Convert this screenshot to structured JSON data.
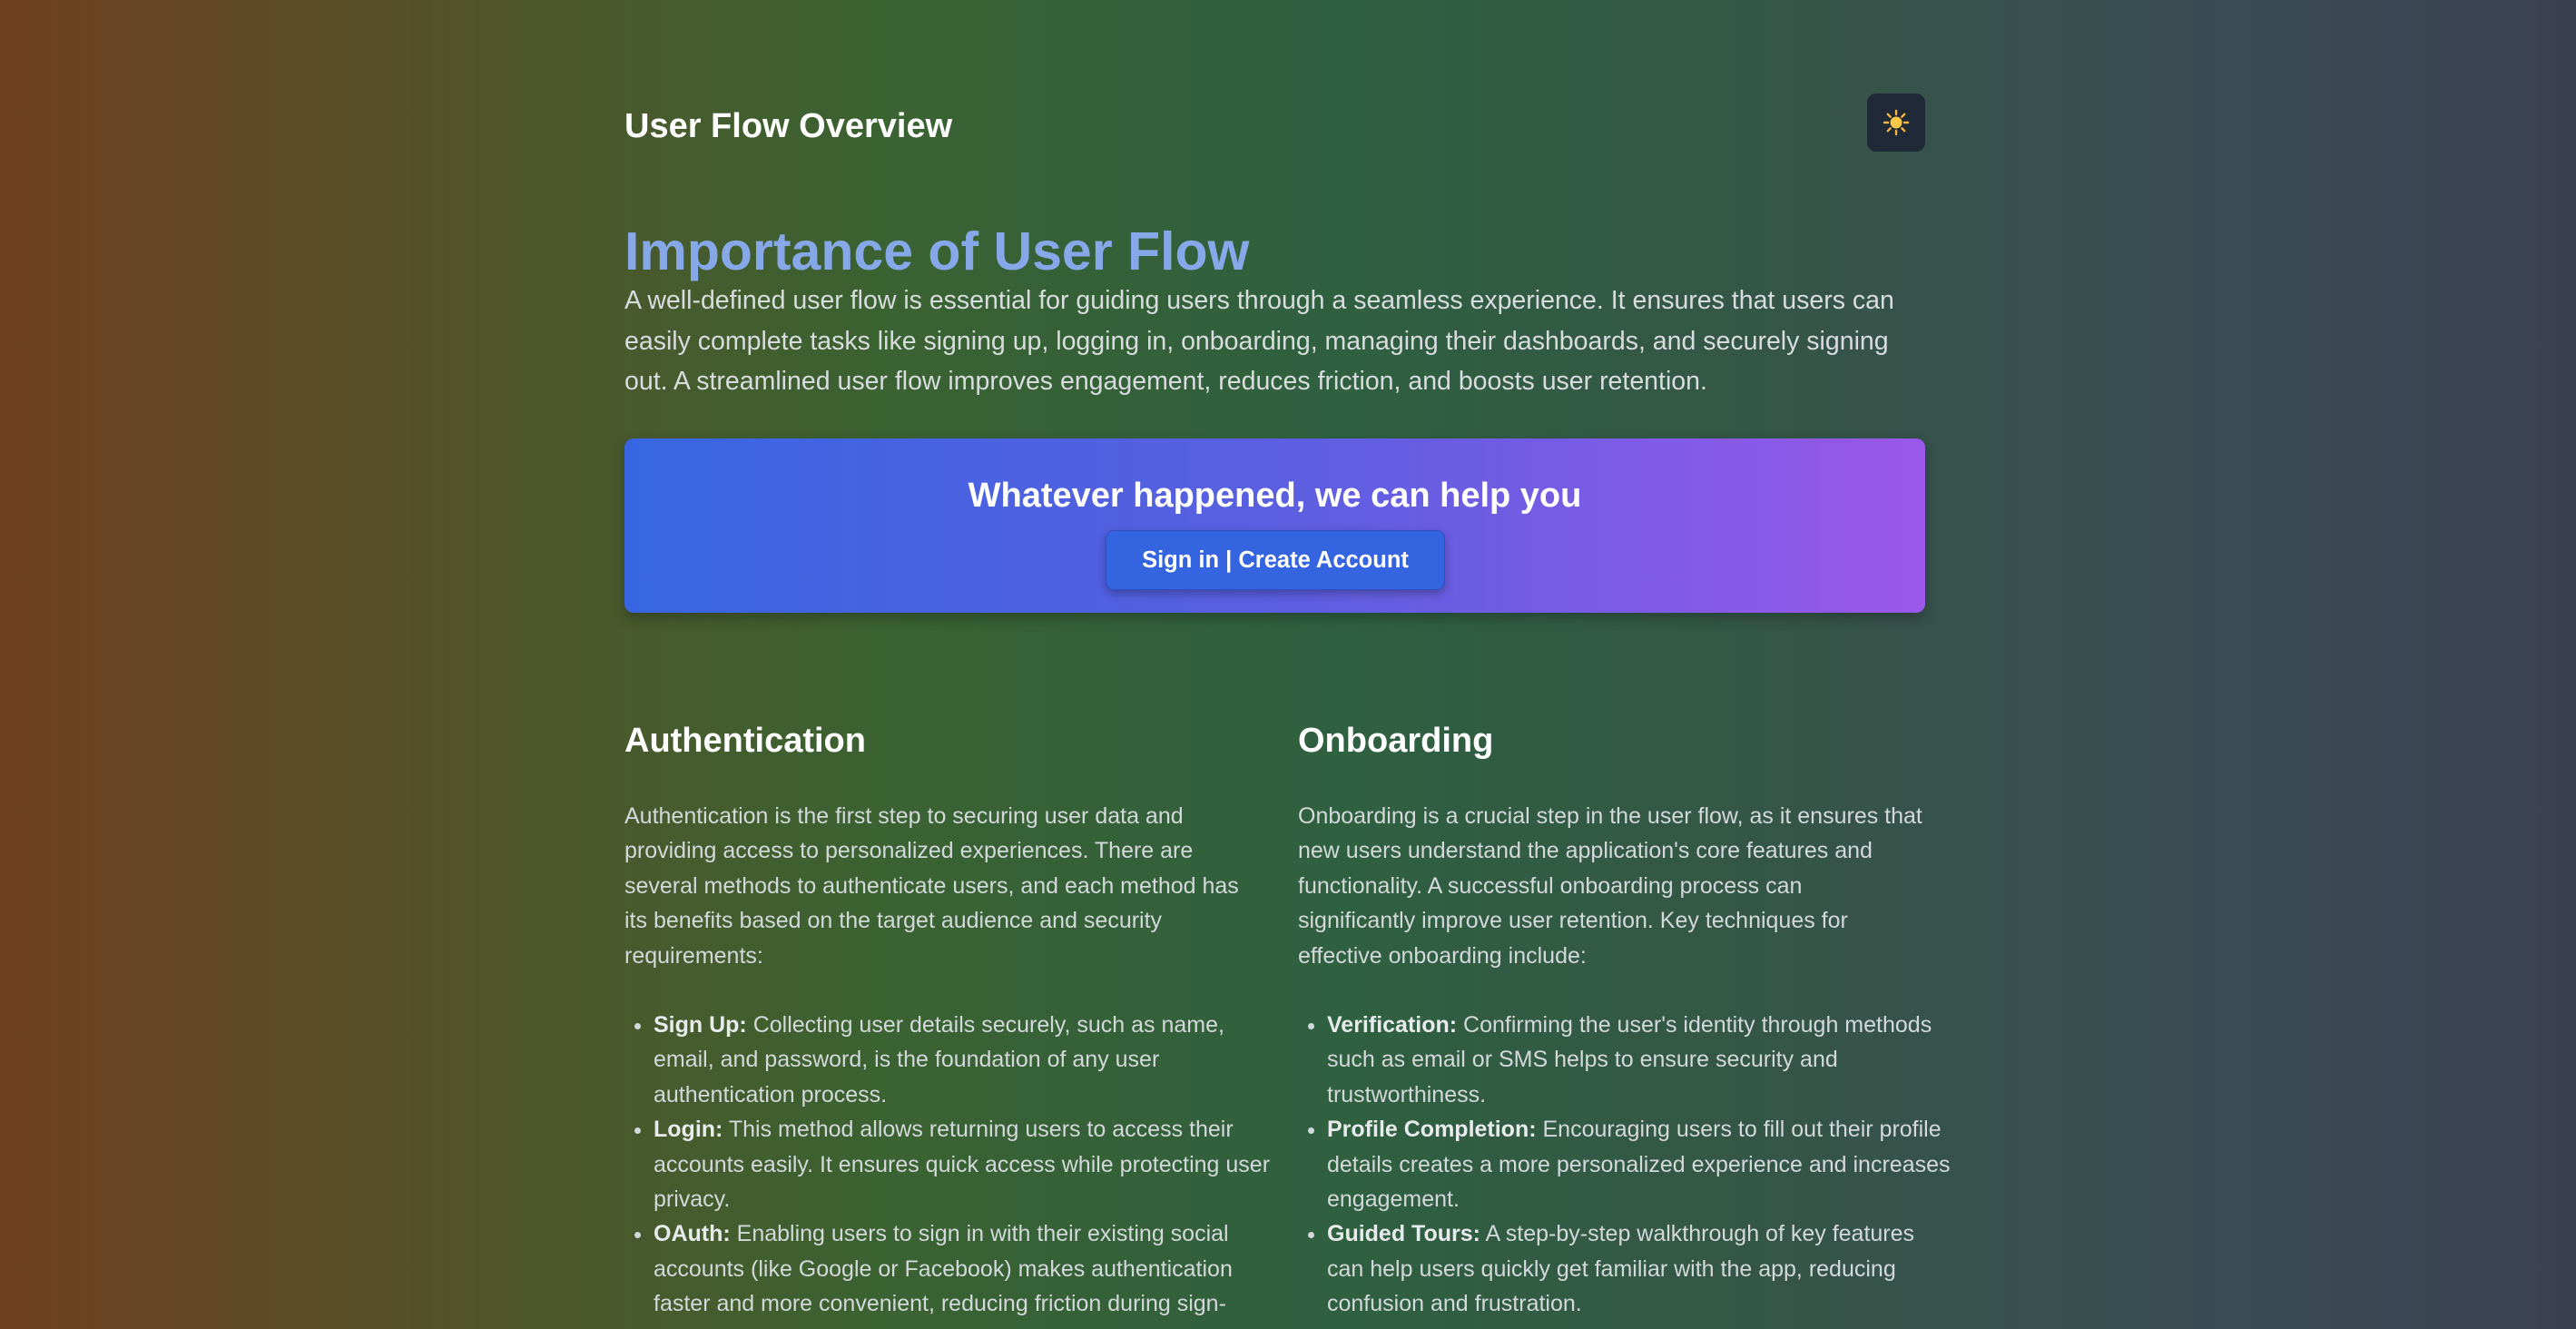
{
  "header": {
    "title": "User Flow Overview",
    "theme_toggle_icon": "sun-icon",
    "theme_toggle_glyph": "☀️"
  },
  "hero": {
    "title": "Importance of User Flow",
    "text": "A well-defined user flow is essential for guiding users through a seamless experience. It ensures that users can easily complete tasks like signing up, logging in, onboarding, managing their dashboards, and securely signing out. A streamlined user flow improves engagement, reduces friction, and boosts user retention."
  },
  "cta": {
    "title": "Whatever happened, we can help you",
    "button_label": "Sign in | Create Account"
  },
  "sections": [
    {
      "title": "Authentication",
      "intro": "Authentication is the first step to securing user data and providing access to personalized experiences. There are several methods to authenticate users, and each method has its benefits based on the target audience and security requirements:",
      "items": [
        {
          "term": "Sign Up:",
          "text": " Collecting user details securely, such as name, email, and password, is the foundation of any user authentication process."
        },
        {
          "term": "Login:",
          "text": " This method allows returning users to access their accounts easily. It ensures quick access while protecting user privacy."
        },
        {
          "term": "OAuth:",
          "text": " Enabling users to sign in with their existing social accounts (like Google or Facebook) makes authentication faster and more convenient, reducing friction during sign-"
        }
      ]
    },
    {
      "title": "Onboarding",
      "intro": "Onboarding is a crucial step in the user flow, as it ensures that new users understand the application's core features and functionality. A successful onboarding process can significantly improve user retention. Key techniques for effective onboarding include:",
      "items": [
        {
          "term": "Verification:",
          "text": " Confirming the user's identity through methods such as email or SMS helps to ensure security and trustworthiness."
        },
        {
          "term": "Profile Completion:",
          "text": " Encouraging users to fill out their profile details creates a more personalized experience and increases engagement."
        },
        {
          "term": "Guided Tours:",
          "text": " A step-by-step walkthrough of key features can help users quickly get familiar with the app, reducing confusion and frustration."
        }
      ]
    }
  ],
  "colors": {
    "hero_title": "#86a7e8",
    "cta_start": "#3866e2",
    "cta_end": "#9a58ea",
    "button": "#3564e0",
    "toggle_bg": "#1f2937"
  }
}
